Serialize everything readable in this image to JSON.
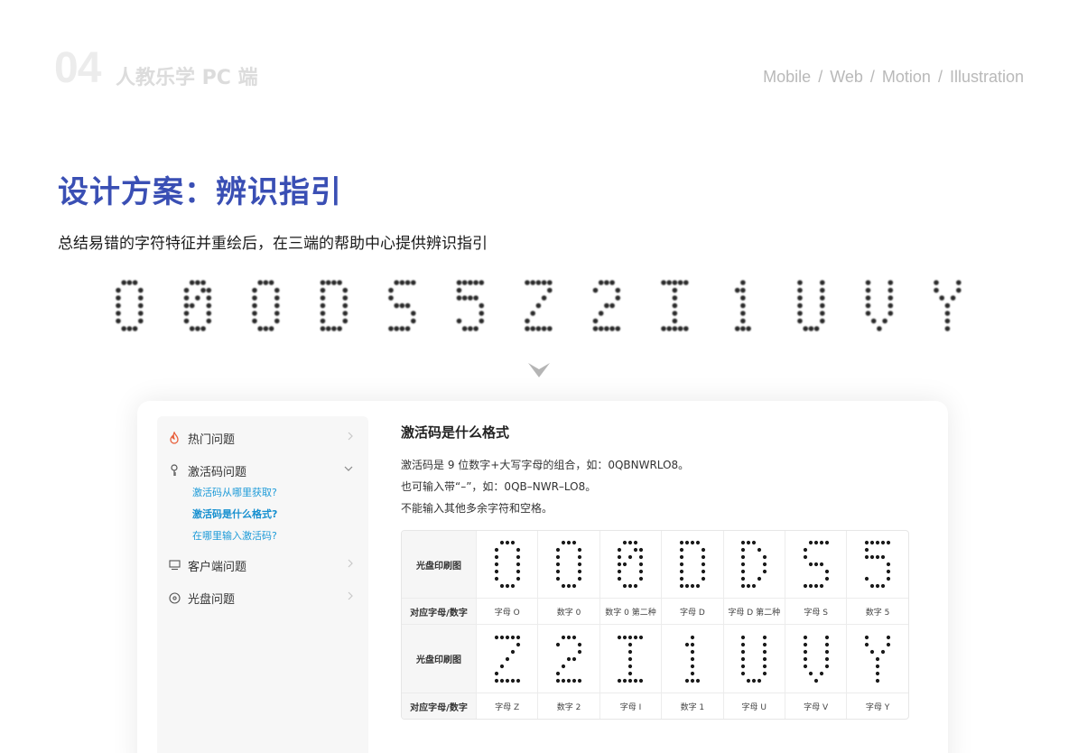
{
  "header": {
    "number": "04",
    "title": "人教乐学 PC 端",
    "nav": [
      "Mobile",
      "Web",
      "Motion",
      "Illustration"
    ],
    "nav_separator": "/"
  },
  "section": {
    "title": "设计方案：辨识指引",
    "subtitle": "总结易错的字符特征并重绘后，在三端的帮助中心提供辨识指引"
  },
  "glyph_strip": [
    "0",
    "0",
    "0",
    "D",
    "S",
    "5",
    "Z",
    "2",
    "I",
    "1",
    "U",
    "V",
    "Y"
  ],
  "help_center": {
    "sidebar": {
      "items": [
        {
          "label": "热门问题",
          "icon": "flame-icon"
        },
        {
          "label": "激活码问题",
          "icon": "key-icon"
        },
        {
          "label": "客户端问题",
          "icon": "monitor-icon"
        },
        {
          "label": "光盘问题",
          "icon": "disc-icon"
        }
      ],
      "subitems": [
        {
          "label": "激活码从哪里获取?"
        },
        {
          "label": "激活码是什么格式?"
        },
        {
          "label": "在哪里输入激活码?"
        }
      ]
    },
    "article": {
      "title": "激活码是什么格式",
      "lines": [
        "激活码是 9 位数字+大写字母的组合，如：0QBNWRLO8。",
        "也可输入带“–”，如：0QB–NWR–LO8。",
        "不能输入其他多余字符和空格。"
      ]
    },
    "table": {
      "row_header_image": "光盘印刷图",
      "row_header_label": "对应字母/数字",
      "group1": [
        "字母 O",
        "数字 0",
        "数字 0 第二种",
        "字母 D",
        "字母 D 第二种",
        "字母 S",
        "数字 5"
      ],
      "group2": [
        "字母 Z",
        "数字 2",
        "字母 I",
        "数字 1",
        "字母 U",
        "字母 V",
        "字母 Y"
      ]
    }
  },
  "colors": {
    "accent": "#3a4fb4",
    "link": "#1e9bd8",
    "flame": "#e8603c"
  }
}
